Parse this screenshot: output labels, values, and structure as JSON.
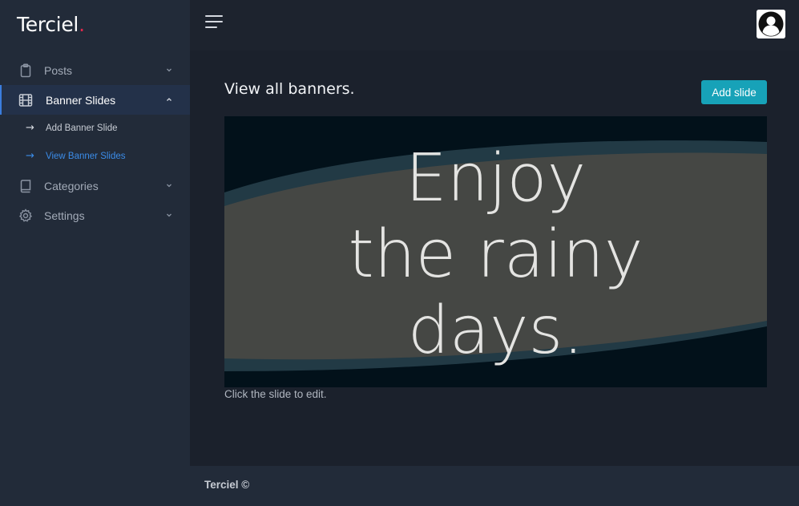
{
  "brand": {
    "name": "Terciel",
    "dot": "."
  },
  "sidebar": {
    "items": [
      {
        "label": "Posts",
        "icon": "clipboard-icon"
      },
      {
        "label": "Banner Slides",
        "icon": "film-icon",
        "active": true,
        "children": [
          {
            "label": "Add Banner Slide",
            "arrow": "→"
          },
          {
            "label": "View Banner Slides",
            "arrow": "→",
            "current": true
          }
        ]
      },
      {
        "label": "Categories",
        "icon": "book-icon"
      },
      {
        "label": "Settings",
        "icon": "gear-icon"
      }
    ]
  },
  "topbar": {
    "menu_icon": "hamburger-icon",
    "avatar_icon": "user-avatar-icon"
  },
  "main": {
    "title": "View all banners.",
    "add_button_label": "Add slide",
    "slide": {
      "lines": [
        "Enjoy",
        "the rainy",
        "days."
      ]
    },
    "hint": "Click the slide to edit."
  },
  "footer": {
    "text": "Terciel ©"
  },
  "colors": {
    "accent": "#17a2b8",
    "brand_dot": "#e0284c",
    "active_link": "#3b8ce8",
    "sidebar_bg": "#222b39",
    "content_bg": "#1b212c"
  }
}
